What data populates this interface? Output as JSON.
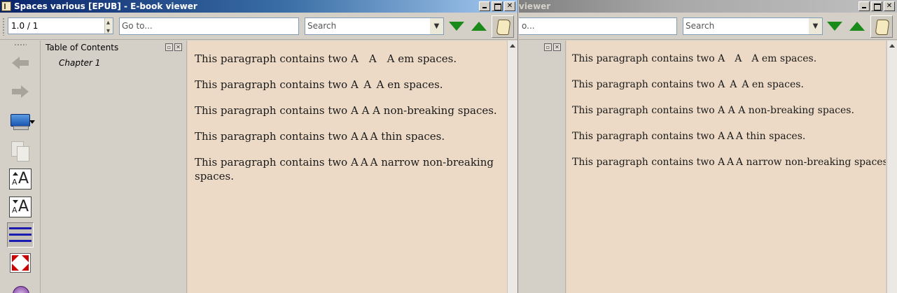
{
  "left_window": {
    "title": "Spaces various [EPUB] - E-book viewer",
    "toolbar": {
      "position_value": "1.0 / 1",
      "goto_placeholder": "Go to...",
      "search_placeholder": "Search"
    },
    "toc": {
      "title": "Table of Contents",
      "items": [
        "Chapter 1"
      ]
    },
    "paragraphs": [
      "This paragraph contains two A A A em spaces.",
      "This paragraph contains two A A A en spaces.",
      "This paragraph contains two A A A non-breaking spaces.",
      "This paragraph contains two A A A thin spaces.",
      "This paragraph contains two A A A narrow non-breaking spaces."
    ]
  },
  "right_window": {
    "title": "viewer",
    "toolbar": {
      "goto_placeholder": "o...",
      "search_placeholder": "Search"
    },
    "paragraphs": [
      "This paragraph contains two A A A em spaces.",
      "This paragraph contains two A A A en spaces.",
      "This paragraph contains two A A A non-breaking spaces.",
      "This paragraph contains two A A A thin spaces.",
      "This paragraph contains two A A A narrow non-breaking spaces."
    ]
  },
  "colors": {
    "title_active": "#0a246a",
    "page_background": "#ecdac6",
    "search_arrow": "#1a8a1a"
  },
  "icons": [
    "app-icon",
    "minimize-icon",
    "maximize-icon",
    "close-icon",
    "next-match-icon",
    "previous-match-icon",
    "reference-mode-icon",
    "back-icon",
    "forward-icon",
    "view-mode-icon",
    "copy-icon",
    "font-larger-icon",
    "font-smaller-icon",
    "table-of-contents-icon",
    "fullscreen-icon",
    "clock-icon"
  ]
}
